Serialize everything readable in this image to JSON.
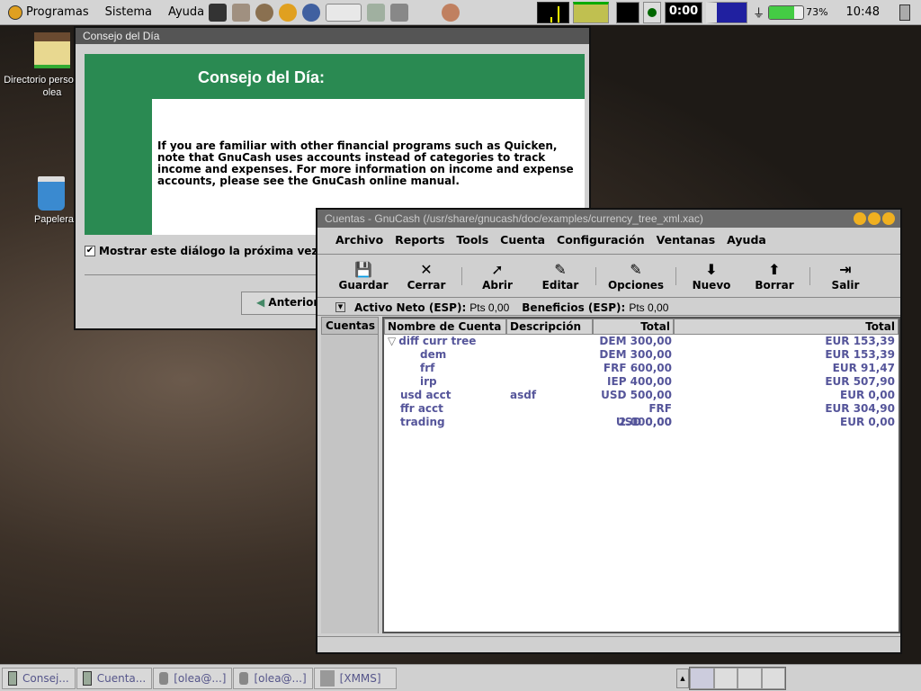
{
  "panel": {
    "menus": [
      "Programas",
      "Sistema",
      "Ayuda"
    ],
    "clock_display": "0:00",
    "battery": "73%",
    "battery_level": 73,
    "time": "10:48"
  },
  "desktop": {
    "icons": [
      {
        "label": "Directorio personal de olea",
        "visible_label": "Directorio perso",
        "sub": "olea",
        "icon": "home-icon"
      },
      {
        "label": "Papelera",
        "icon": "trash-icon"
      }
    ]
  },
  "tip_dialog": {
    "title": "Consejo del Día",
    "heading": "Consejo del Día:",
    "body": "If you are familiar with other financial programs such as Quicken, note that GnuCash uses accounts instead of categories to track income and expenses.  For more information on income and expense accounts, please see the GnuCash online manual.",
    "checkbox": "Mostrar este diálogo la próxima vez",
    "checked": true,
    "prev_button": "Anterior"
  },
  "gnucash": {
    "title": "Cuentas - GnuCash (/usr/share/gnucash/doc/examples/currency_tree_xml.xac)",
    "menu": [
      "Archivo",
      "Reports",
      "Tools",
      "Cuenta",
      "Configuración",
      "Ventanas",
      "Ayuda"
    ],
    "toolbar": [
      "Guardar",
      "Cerrar",
      "Abrir",
      "Editar",
      "Opciones",
      "Nuevo",
      "Borrar",
      "Salir"
    ],
    "summary": {
      "net_label": "Activo Neto (ESP):",
      "net_value": "Pts 0,00",
      "profit_label": "Beneficios (ESP):",
      "profit_value": "Pts 0,00"
    },
    "tab": "Cuentas",
    "columns": [
      "Nombre de Cuenta",
      "Descripción",
      "Total",
      "Total"
    ],
    "rows": [
      {
        "name": "diff curr tree",
        "desc": "",
        "total": "DEM 300,00",
        "total2": "EUR 153,39",
        "level": 0,
        "expanded": true
      },
      {
        "name": "dem",
        "desc": "",
        "total": "DEM 300,00",
        "total2": "EUR 153,39",
        "level": 1
      },
      {
        "name": "frf",
        "desc": "",
        "total": "FRF 600,00",
        "total2": "EUR 91,47",
        "level": 1
      },
      {
        "name": "irp",
        "desc": "",
        "total": "IEP 400,00",
        "total2": "EUR 507,90",
        "level": 1
      },
      {
        "name": "usd acct",
        "desc": "asdf",
        "total": "USD 500,00",
        "total2": "EUR 0,00",
        "level": 0
      },
      {
        "name": "ffr acct",
        "desc": "",
        "total": "FRF 2.000,00",
        "total2": "EUR 304,90",
        "level": 0
      },
      {
        "name": "trading",
        "desc": "",
        "total": "USD 0,00",
        "total2": "EUR 0,00",
        "level": 0
      }
    ]
  },
  "taskbar": {
    "tasks": [
      "Consej...",
      "Cuenta...",
      "[olea@...]",
      "[olea@...]",
      "[XMMS]"
    ]
  },
  "colors": {
    "tip_green": "#2a8a52",
    "account_text": "#55559a"
  }
}
